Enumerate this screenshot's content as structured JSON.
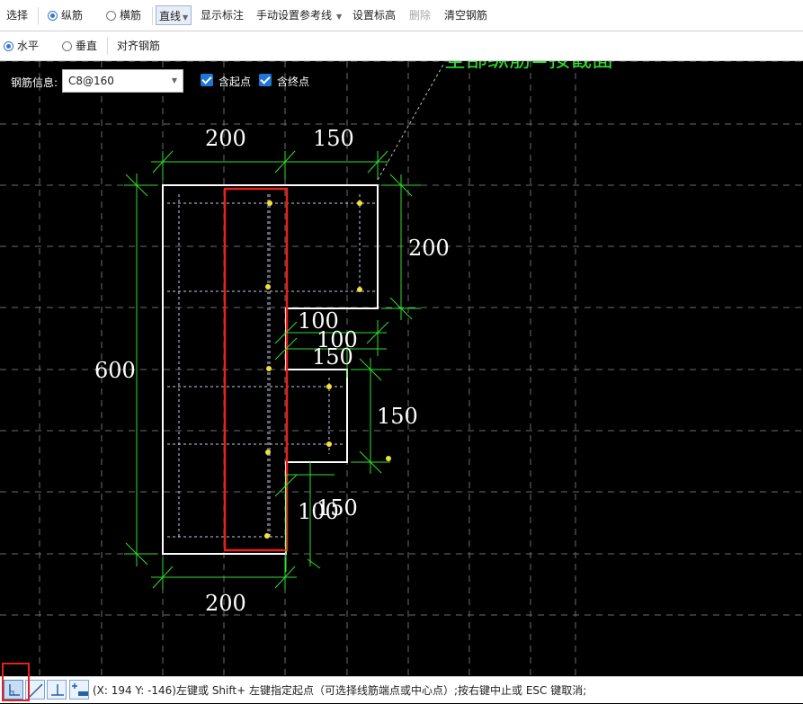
{
  "toolbar1": {
    "select": "选择",
    "longitudinal": "纵筋",
    "stirrup": "横筋",
    "line_mode": "直线",
    "show_dims": "显示标注",
    "manual_ref": "手动设置参考线",
    "set_elevation": "设置标高",
    "delete": "删除",
    "clear_rebar": "清空钢筋"
  },
  "toolbar2": {
    "horizontal": "水平",
    "vertical": "垂直",
    "align_rebar": "对齐钢筋"
  },
  "rebar_info": {
    "label": "钢筋信息:",
    "value": "C8@160",
    "start_point": "含起点",
    "end_point": "含终点"
  },
  "drawing": {
    "top_note": "全部纵筋=按截面",
    "dims": {
      "top_left": "200",
      "top_right": "150",
      "right_upper": "200",
      "step1_a": "100",
      "step1_b": "100",
      "step1_c": "150",
      "right_mid": "150",
      "left_height": "600",
      "bottom_step_a": "100",
      "bottom_step_b": "150",
      "bottom": "200"
    }
  },
  "statusbar": {
    "coords": "(X: 194 Y: -146)",
    "message": "左键或 Shift+ 左键指定起点（可选择线筋端点或中心点）;按右键中止或 ESC 键取消;"
  },
  "colors": {
    "accent": "#3a78c9",
    "dim_line": "#2ee02e",
    "rebar_highlight": "#e8201a",
    "point": "#f2e13a"
  }
}
